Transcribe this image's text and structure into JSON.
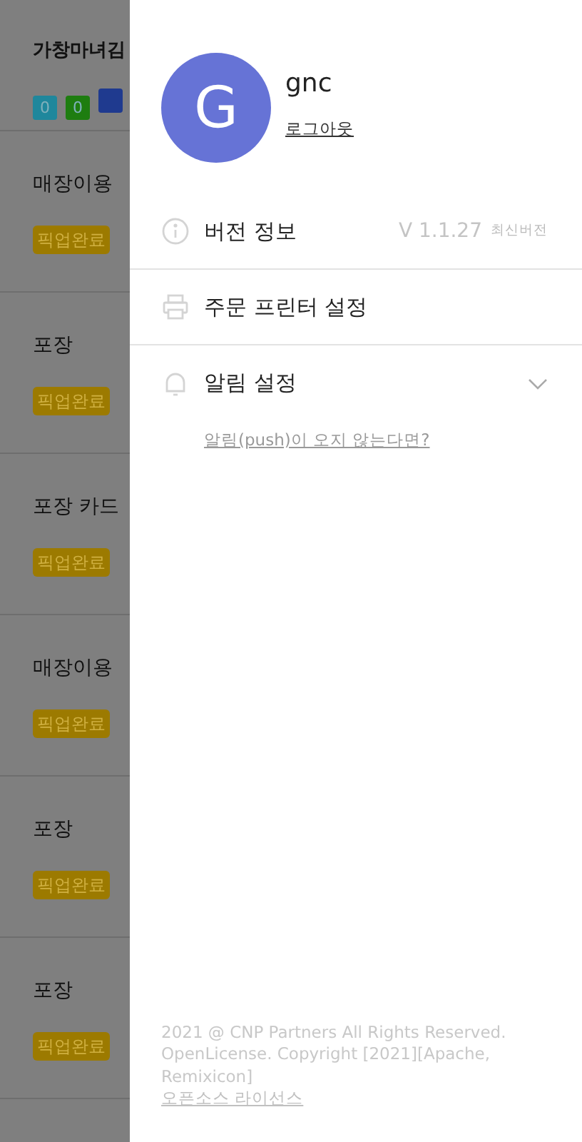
{
  "background": {
    "title": "가창마녀김",
    "counters": [
      {
        "label": "0",
        "color": "#1f879c"
      },
      {
        "label": "0",
        "color": "#1e7d10"
      },
      {
        "color": "#1f3a8f"
      }
    ],
    "orders": [
      {
        "type": "매장이용",
        "status": "픽업완료"
      },
      {
        "type": "포장",
        "status": "픽업완료"
      },
      {
        "type": "포장 카드",
        "status": "픽업완료"
      },
      {
        "type": "매장이용",
        "status": "픽업완료"
      },
      {
        "type": "포장",
        "status": "픽업완료"
      },
      {
        "type": "포장",
        "status": "픽업완료"
      }
    ]
  },
  "drawer": {
    "user": {
      "initial": "G",
      "name": "gnc",
      "logout": "로그아웃"
    },
    "menu": [
      {
        "kind": "info",
        "label": "버전 정보",
        "value": "V 1.1.27",
        "note": "최신버전"
      },
      {
        "kind": "printer",
        "label": "주문 프린터 설정"
      },
      {
        "kind": "bell",
        "label": "알림 설정",
        "chevron": true
      }
    ],
    "help_link": "알림(push)이 오지 않는다면?",
    "footer": {
      "lines": [
        "2021 @ CNP Partners All Rights Reserved.",
        "OpenLicense. Copyright [2021][Apache, Remixicon]"
      ],
      "link": "오픈소스 라이선스"
    }
  }
}
